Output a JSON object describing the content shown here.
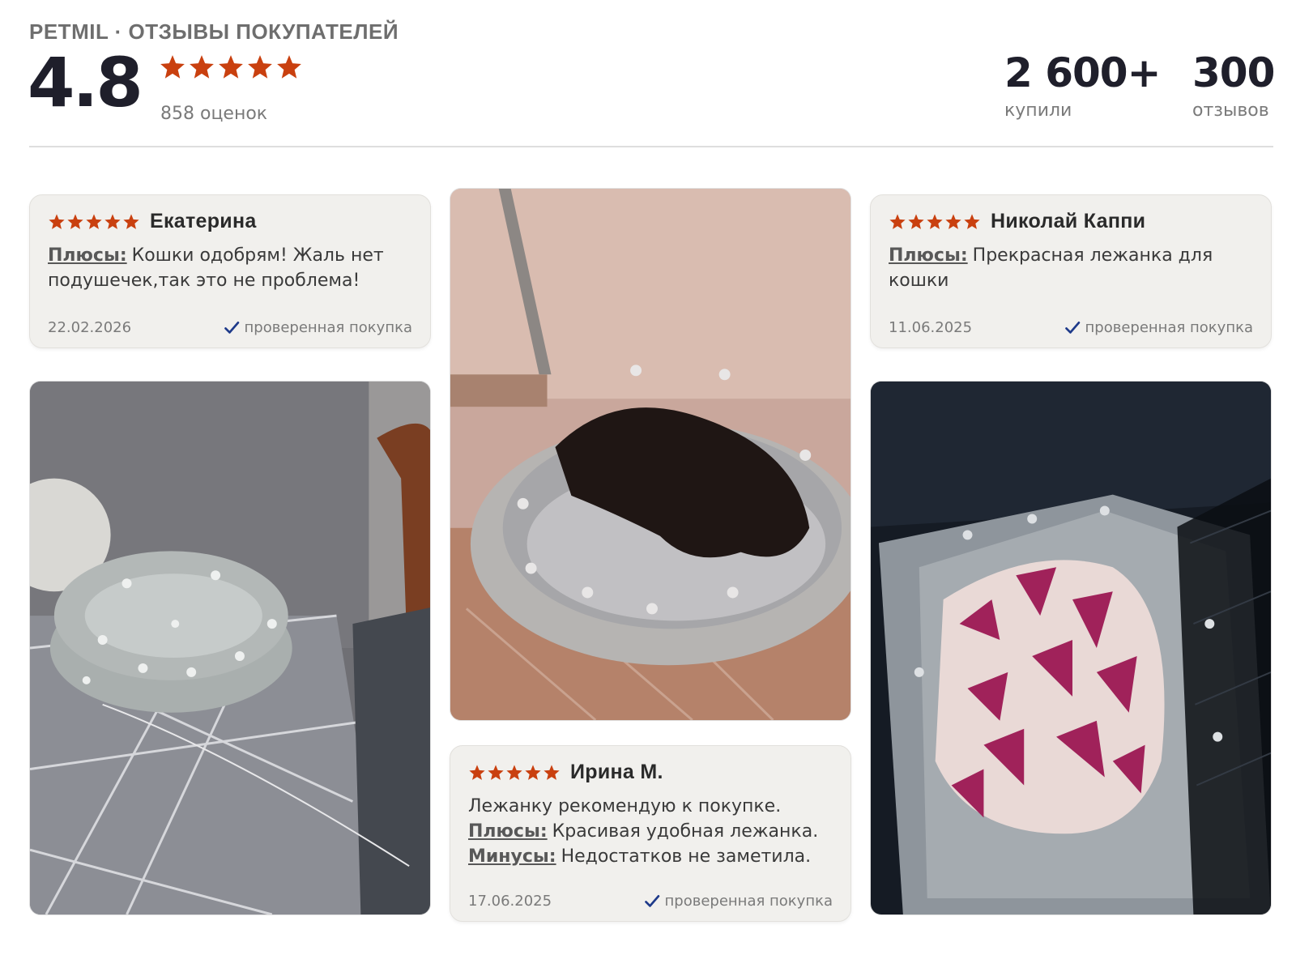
{
  "header": {
    "brand_title": "PETMIL · ОТЗЫВЫ ПОКУПАТЕЛЕЙ",
    "score": "4.8",
    "stars": 5,
    "ratings_count": "858 оценок",
    "bought_value": "2 600+",
    "bought_label": "купили",
    "reviews_value": "300",
    "reviews_label": "отзывов"
  },
  "colors": {
    "star": "#c9400f",
    "check": "#1e3a8a",
    "card_bg": "#f1f0ed"
  },
  "reviews": [
    {
      "author": "Екатерина",
      "stars": 5,
      "pros_label": "Плюсы:",
      "pros_text": "Кошки одобрям! Жаль нет подушечек,так это не проблема!",
      "date": "22.02.2026",
      "verified_label": "проверенная покупка"
    },
    {
      "author": "Николай Каппи",
      "stars": 5,
      "pros_label": "Плюсы:",
      "pros_text": "Прекрасная лежанка для кошки",
      "date": "11.06.2025",
      "verified_label": "проверенная покупка"
    },
    {
      "author": "Ирина М.",
      "stars": 5,
      "text": "Лежанку рекомендую к покупке.",
      "pros_label": "Плюсы:",
      "pros_text": "Красивая удобная лежанка.",
      "cons_label": "Минусы:",
      "cons_text": "Недостатков не заметила.",
      "date": "17.06.2025",
      "verified_label": "проверенная покупка"
    }
  ],
  "photos": [
    {
      "subject": "grey star-print pet bed on a table"
    },
    {
      "subject": "black cat sleeping in grey star-print bed"
    },
    {
      "subject": "star-print bed with pink flower blanket in carrier"
    }
  ]
}
